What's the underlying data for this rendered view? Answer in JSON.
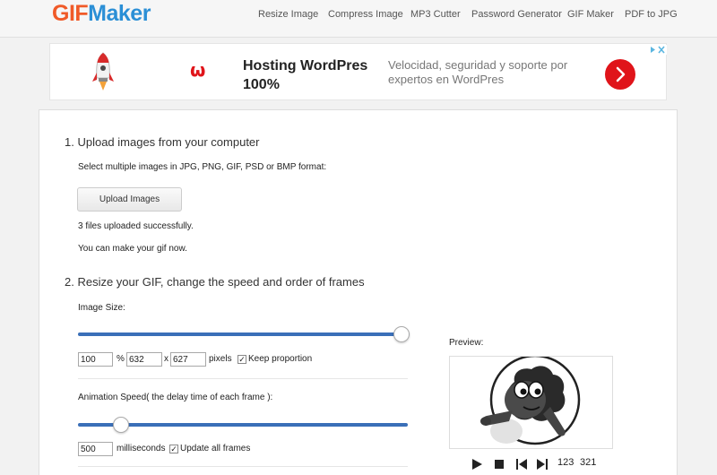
{
  "header": {
    "logo_part1": "GIF",
    "logo_part2": "Maker",
    "nav": [
      "Resize Image",
      "Compress Image",
      "MP3 Cutter",
      "Password Generator",
      "GIF Maker",
      "PDF to JPG"
    ]
  },
  "ad": {
    "logo_text": "ω",
    "title": "Hosting WordPres 100%",
    "description": "Velocidad, seguridad y soporte por expertos en WordPres"
  },
  "step1": {
    "title": "1. Upload images from your computer",
    "instructions": "Select multiple images in JPG, PNG, GIF, PSD or BMP format:",
    "upload_button": "Upload Images",
    "status": "3 files uploaded successfully.",
    "hint": "You can make your gif now."
  },
  "step2": {
    "title": "2. Resize your GIF, change the speed and order of frames",
    "image_size_label": "Image Size:",
    "size_slider_value": 1.0,
    "percent_value": "100",
    "percent_sign": "%",
    "width_value": "632",
    "x_sep": "x",
    "height_value": "627",
    "pixels_label": "pixels",
    "keep_proportion_label": "Keep proportion",
    "keep_proportion_checked": true,
    "speed_label": "Animation Speed( the delay time of each frame ):",
    "speed_slider_value": 0.11,
    "delay_value": "500",
    "ms_label": "milliseconds",
    "update_all_label": "Update all frames",
    "update_all_checked": true
  },
  "preview": {
    "label": "Preview:",
    "order_asc": "123",
    "order_desc": "321"
  },
  "colors": {
    "logo_orange": "#f05a28",
    "logo_blue": "#2b8fd6",
    "slider_blue": "#3a6fb8",
    "ad_red": "#e0141a"
  }
}
